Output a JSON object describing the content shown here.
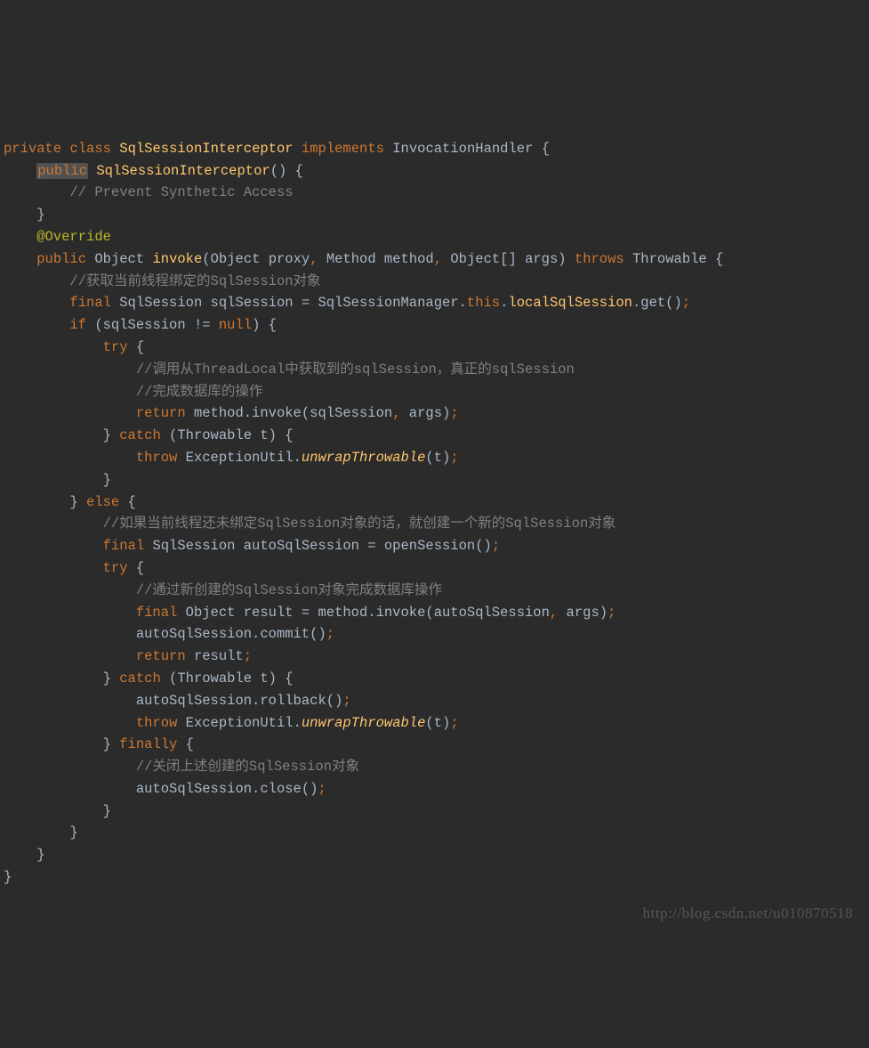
{
  "watermark": "http://blog.csdn.net/u010870518",
  "lines": [
    {
      "indent": 0,
      "tokens": [
        {
          "t": "private",
          "c": "kw"
        },
        {
          "t": " ",
          "c": "plain"
        },
        {
          "t": "class",
          "c": "kw"
        },
        {
          "t": " ",
          "c": "plain"
        },
        {
          "t": "SqlSessionInterceptor",
          "c": "meth"
        },
        {
          "t": " ",
          "c": "plain"
        },
        {
          "t": "implements",
          "c": "kw"
        },
        {
          "t": " ",
          "c": "plain"
        },
        {
          "t": "InvocationHandler",
          "c": "cls"
        },
        {
          "t": " {",
          "c": "plain"
        }
      ]
    },
    {
      "indent": 1,
      "tokens": [
        {
          "t": "public",
          "c": "kw",
          "hl": true
        },
        {
          "t": " ",
          "c": "plain"
        },
        {
          "t": "SqlSessionInterceptor",
          "c": "meth"
        },
        {
          "t": "() {",
          "c": "plain"
        }
      ]
    },
    {
      "indent": 2,
      "tokens": [
        {
          "t": "// Prevent Synthetic Access",
          "c": "cmt"
        }
      ]
    },
    {
      "indent": 1,
      "tokens": [
        {
          "t": "}",
          "c": "plain"
        }
      ]
    },
    {
      "indent": 0,
      "tokens": [
        {
          "t": "",
          "c": "plain"
        }
      ]
    },
    {
      "indent": 1,
      "tokens": [
        {
          "t": "@Override",
          "c": "ann"
        }
      ]
    },
    {
      "indent": 1,
      "tokens": [
        {
          "t": "public",
          "c": "kw"
        },
        {
          "t": " ",
          "c": "plain"
        },
        {
          "t": "Object",
          "c": "cls"
        },
        {
          "t": " ",
          "c": "plain"
        },
        {
          "t": "invoke",
          "c": "meth"
        },
        {
          "t": "(Object proxy",
          "c": "plain"
        },
        {
          "t": ",",
          "c": "kw"
        },
        {
          "t": " Method method",
          "c": "plain"
        },
        {
          "t": ",",
          "c": "kw"
        },
        {
          "t": " Object[] args) ",
          "c": "plain"
        },
        {
          "t": "throws",
          "c": "kw"
        },
        {
          "t": " Throwable {",
          "c": "plain"
        }
      ]
    },
    {
      "indent": 2,
      "tokens": [
        {
          "t": "//获取当前线程绑定的SqlSession对象",
          "c": "cmt"
        }
      ]
    },
    {
      "indent": 2,
      "tokens": [
        {
          "t": "final",
          "c": "kw"
        },
        {
          "t": " SqlSession sqlSession = SqlSessionManager.",
          "c": "plain"
        },
        {
          "t": "this",
          "c": "kw"
        },
        {
          "t": ".",
          "c": "plain"
        },
        {
          "t": "localSqlSession",
          "c": "meth"
        },
        {
          "t": ".get()",
          "c": "plain"
        },
        {
          "t": ";",
          "c": "kw"
        }
      ]
    },
    {
      "indent": 2,
      "tokens": [
        {
          "t": "if",
          "c": "kw"
        },
        {
          "t": " (sqlSession != ",
          "c": "plain"
        },
        {
          "t": "null",
          "c": "kw"
        },
        {
          "t": ") {",
          "c": "plain"
        }
      ]
    },
    {
      "indent": 3,
      "tokens": [
        {
          "t": "try",
          "c": "kw"
        },
        {
          "t": " {",
          "c": "plain"
        }
      ]
    },
    {
      "indent": 4,
      "tokens": [
        {
          "t": "//调用从ThreadLocal中获取到的sqlSession，真正的sqlSession",
          "c": "cmt"
        }
      ]
    },
    {
      "indent": 4,
      "tokens": [
        {
          "t": "//完成数据库的操作",
          "c": "cmt"
        }
      ]
    },
    {
      "indent": 4,
      "tokens": [
        {
          "t": "return",
          "c": "kw"
        },
        {
          "t": " method.invoke(sqlSession",
          "c": "plain"
        },
        {
          "t": ",",
          "c": "kw"
        },
        {
          "t": " args)",
          "c": "plain"
        },
        {
          "t": ";",
          "c": "kw"
        }
      ]
    },
    {
      "indent": 3,
      "tokens": [
        {
          "t": "} ",
          "c": "plain"
        },
        {
          "t": "catch",
          "c": "kw"
        },
        {
          "t": " (Throwable t) {",
          "c": "plain"
        }
      ]
    },
    {
      "indent": 4,
      "tokens": [
        {
          "t": "throw",
          "c": "kw"
        },
        {
          "t": " ExceptionUtil.",
          "c": "plain"
        },
        {
          "t": "unwrapThrowable",
          "c": "meth ital"
        },
        {
          "t": "(t)",
          "c": "plain"
        },
        {
          "t": ";",
          "c": "kw"
        }
      ]
    },
    {
      "indent": 3,
      "tokens": [
        {
          "t": "}",
          "c": "plain"
        }
      ]
    },
    {
      "indent": 2,
      "tokens": [
        {
          "t": "} ",
          "c": "plain"
        },
        {
          "t": "else",
          "c": "kw"
        },
        {
          "t": " {",
          "c": "plain"
        }
      ]
    },
    {
      "indent": 3,
      "tokens": [
        {
          "t": "//如果当前线程还未绑定SqlSession对象的话，就创建一个新的SqlSession对象",
          "c": "cmt"
        }
      ]
    },
    {
      "indent": 3,
      "tokens": [
        {
          "t": "final",
          "c": "kw"
        },
        {
          "t": " SqlSession autoSqlSession = openSession()",
          "c": "plain"
        },
        {
          "t": ";",
          "c": "kw"
        }
      ]
    },
    {
      "indent": 3,
      "tokens": [
        {
          "t": "try",
          "c": "kw"
        },
        {
          "t": " {",
          "c": "plain"
        }
      ]
    },
    {
      "indent": 4,
      "tokens": [
        {
          "t": "//通过新创建的SqlSession对象完成数据库操作",
          "c": "cmt"
        }
      ]
    },
    {
      "indent": 4,
      "tokens": [
        {
          "t": "final",
          "c": "kw"
        },
        {
          "t": " Object result = method.invoke(autoSqlSession",
          "c": "plain"
        },
        {
          "t": ",",
          "c": "kw"
        },
        {
          "t": " args)",
          "c": "plain"
        },
        {
          "t": ";",
          "c": "kw"
        }
      ]
    },
    {
      "indent": 4,
      "tokens": [
        {
          "t": "autoSqlSession.commit()",
          "c": "plain"
        },
        {
          "t": ";",
          "c": "kw"
        }
      ]
    },
    {
      "indent": 4,
      "tokens": [
        {
          "t": "return",
          "c": "kw"
        },
        {
          "t": " result",
          "c": "plain"
        },
        {
          "t": ";",
          "c": "kw"
        }
      ]
    },
    {
      "indent": 3,
      "tokens": [
        {
          "t": "} ",
          "c": "plain"
        },
        {
          "t": "catch",
          "c": "kw"
        },
        {
          "t": " (Throwable t) {",
          "c": "plain"
        }
      ]
    },
    {
      "indent": 4,
      "tokens": [
        {
          "t": "autoSqlSession.rollback()",
          "c": "plain"
        },
        {
          "t": ";",
          "c": "kw"
        }
      ]
    },
    {
      "indent": 4,
      "tokens": [
        {
          "t": "throw",
          "c": "kw"
        },
        {
          "t": " ExceptionUtil.",
          "c": "plain"
        },
        {
          "t": "unwrapThrowable",
          "c": "meth ital"
        },
        {
          "t": "(t)",
          "c": "plain"
        },
        {
          "t": ";",
          "c": "kw"
        }
      ]
    },
    {
      "indent": 3,
      "tokens": [
        {
          "t": "} ",
          "c": "plain"
        },
        {
          "t": "finally",
          "c": "kw"
        },
        {
          "t": " {",
          "c": "plain"
        }
      ]
    },
    {
      "indent": 4,
      "tokens": [
        {
          "t": "//关闭上述创建的SqlSession对象",
          "c": "cmt"
        }
      ]
    },
    {
      "indent": 4,
      "tokens": [
        {
          "t": "autoSqlSession.close()",
          "c": "plain"
        },
        {
          "t": ";",
          "c": "kw"
        }
      ]
    },
    {
      "indent": 3,
      "tokens": [
        {
          "t": "}",
          "c": "plain"
        }
      ]
    },
    {
      "indent": 2,
      "tokens": [
        {
          "t": "}",
          "c": "plain"
        }
      ]
    },
    {
      "indent": 1,
      "tokens": [
        {
          "t": "}",
          "c": "plain"
        }
      ]
    },
    {
      "indent": 0,
      "tokens": [
        {
          "t": "}",
          "c": "plain"
        }
      ]
    }
  ]
}
